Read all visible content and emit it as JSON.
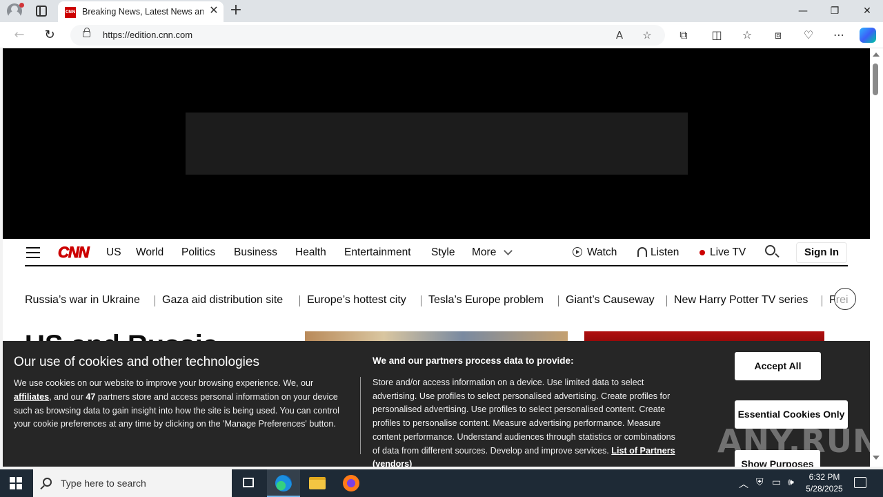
{
  "browser": {
    "tab_title": "Breaking News, Latest News and",
    "tab_favicon_text": "CNN",
    "url": "https://edition.cnn.com",
    "icons": [
      "back-icon",
      "refresh-icon",
      "lock-icon",
      "read-aloud-icon",
      "favorite-star-icon",
      "extensions-icon",
      "split-screen-icon",
      "favorites-icon",
      "collections-icon",
      "browser-essentials-icon",
      "more-icon",
      "copilot-icon"
    ]
  },
  "cnn": {
    "logo": "CNN",
    "nav": [
      "US",
      "World",
      "Politics",
      "Business",
      "Health",
      "Entertainment",
      "Style",
      "More"
    ],
    "watch": "Watch",
    "listen": "Listen",
    "live_tv": "Live TV",
    "sign_in": "Sign In",
    "trending": [
      "Russia’s war in Ukraine",
      "Gaza aid distribution site",
      "Europe’s hottest city",
      "Tesla’s Europe problem",
      "Giant’s Causeway",
      "New Harry Potter TV series",
      "Frei"
    ],
    "headline_peek": "US and Russia"
  },
  "cookie": {
    "title": "Our use of cookies and other technologies",
    "body_1": "We use cookies on our website to improve your browsing experience. We, our ",
    "affiliates": "affiliates",
    "body_2": ", and our ",
    "partner_count": "47",
    "body_3": " partners store and access personal information on your device such as browsing data to gain insight into how the site is being used. You can control your cookie preferences at any time by clicking on the 'Manage Preferences' button.",
    "subtitle": "We and our partners process data to provide:",
    "purposes": "Store and/or access information on a device. Use limited data to select advertising. Use profiles to select personalised advertising. Create profiles for personalised advertising. Use profiles to select personalised content. Create profiles to personalise content. Measure advertising performance. Measure content performance. Understand audiences through statistics or combinations of data from different sources. Develop and improve services. ",
    "partners_link": "List of Partners (vendors)",
    "accept_all": "Accept All",
    "essential_only": "Essential Cookies Only",
    "show_purposes": "Show Purposes"
  },
  "watermark": "ANY.RUN",
  "taskbar": {
    "search_placeholder": "Type here to search",
    "time": "6:32 PM",
    "date": "5/28/2025"
  }
}
